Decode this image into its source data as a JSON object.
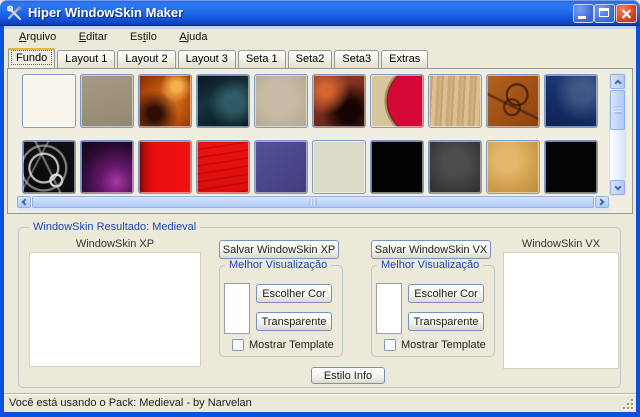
{
  "titlebar": {
    "title": "Hiper WindowSkin Maker",
    "icon": "crossed-tools-icon"
  },
  "window_controls": {
    "minimize": "minimize-icon",
    "maximize": "maximize-icon",
    "close": "close-icon"
  },
  "menu": {
    "items": [
      {
        "label": "Arquivo",
        "mnemonic": "A"
      },
      {
        "label": "Editar",
        "mnemonic": "E"
      },
      {
        "label": "Estilo",
        "mnemonic": "t"
      },
      {
        "label": "Ajuda",
        "mnemonic": "A"
      }
    ]
  },
  "tabs": [
    {
      "label": "Fundo",
      "selected": true
    },
    {
      "label": "Layout 1",
      "selected": false
    },
    {
      "label": "Layout 2",
      "selected": false
    },
    {
      "label": "Layout 3",
      "selected": false
    },
    {
      "label": "Seta 1",
      "selected": false
    },
    {
      "label": "Seta2",
      "selected": false
    },
    {
      "label": "Seta3",
      "selected": false
    },
    {
      "label": "Extras",
      "selected": false
    }
  ],
  "swatches": {
    "rows": [
      [
        {
          "name": "cream",
          "bg": "#f6f4eb"
        },
        {
          "name": "taupe",
          "bg": "linear-gradient(165deg,#a59a84,#93886f)"
        },
        {
          "name": "fire-marble",
          "bg": "radial-gradient(circle at 72% 22%, #f5b24a 0 8%, rgba(0,0,0,0) 30%), radial-gradient(circle at 30% 75%, #2d0d04 0 12%, rgba(0,0,0,0) 45%), radial-gradient(circle at 55% 55%, #e07a1e, #b44a0c 55%, #7e2a06)"
        },
        {
          "name": "dark-teal-stone",
          "bg": "radial-gradient(circle at 70% 55%, rgba(90,160,170,.4) 0 20%, rgba(0,0,0,0) 55%), linear-gradient(160deg,#0c1722 0%,#15333e 45%,#0a141e 100%)"
        },
        {
          "name": "sand",
          "bg": "radial-gradient(circle at 45% 45%, #c6bba4 0 40%, #b2a68e)"
        },
        {
          "name": "ember-rust",
          "bg": "radial-gradient(circle at 25% 30%, #d46630 0 10%, rgba(0,0,0,0) 45%), radial-gradient(circle at 70% 70%, #160503 0 20%, rgba(0,0,0,0) 55%), linear-gradient(150deg,#93402a,#5f1d10)"
        },
        {
          "name": "red-cream-curve",
          "bg": "radial-gradient(150% 130% at 118% 50%, #d40a34 0 56%, #a2132f 57% 58.5%, #a78b5e 59% 61%, #d6c69c 62%)"
        },
        {
          "name": "light-wood",
          "bg": "repeating-linear-gradient(93deg,#d3b183 0 2px,#c5a272 2px 4px,#dcbf92 4px 8px,#caa878 8px 11px)"
        },
        {
          "name": "dragon-etch",
          "bg": "radial-gradient(circle 12px at 58% 38%, rgba(0,0,0,0) 9px, rgba(50,22,6,.75) 9.5px 11px, rgba(0,0,0,0) 12px), radial-gradient(circle 9px at 48% 62%, rgba(0,0,0,0) 6.5px, rgba(50,22,6,.7) 7px 8.5px, rgba(0,0,0,0) 9.5px), linear-gradient(26deg, rgba(0,0,0,0) 40%, rgba(55,25,8,.6) 42% 43.5%, rgba(0,0,0,0) 46%), linear-gradient(135deg,#b2621f,#8f420e)"
        },
        {
          "name": "navy-smoke",
          "bg": "radial-gradient(circle at 70% 35%, rgba(130,150,170,.35) 0 18%, rgba(0,0,0,0) 55%), linear-gradient(205deg,#28477c 0%,#17316c 45%,#0e2252 100%)"
        }
      ],
      [
        {
          "name": "rune-circle",
          "bg": "radial-gradient(circle 16px at 40% 52%, rgba(0,0,0,0) 13px, rgba(230,230,230,.8) 13.5px 15px, rgba(0,0,0,0) 16px), radial-gradient(circle 24px at 40% 52%, rgba(0,0,0,0) 21px, rgba(200,200,200,.6) 21.5px 23px, rgba(0,0,0,0) 24px), radial-gradient(circle 7px at 64% 76%, rgba(0,0,0,0) 4.5px, rgba(240,240,240,.9) 5px 6.5px, rgba(0,0,0,0) 7.5px), linear-gradient(64deg, rgba(0,0,0,0) 46%, rgba(220,220,220,.5) 48% 49%, rgba(0,0,0,0) 51%), linear-gradient(118deg, rgba(0,0,0,0) 30%, rgba(220,220,220,.45) 31.5% 32.5%, rgba(0,0,0,0) 34%), linear-gradient(#101010,#0a0a0a)"
        },
        {
          "name": "purple-nebula",
          "bg": "radial-gradient(circle at 68% 78%, #a637a3 0%, #63176a 30%, #2c0a33 65%, #150419 100%)"
        },
        {
          "name": "red-shaded-edge",
          "bg": "linear-gradient(90deg,#6f0606 0%,#b50b0b 10%,#ea0f0f 28%,#f01212 100%)"
        },
        {
          "name": "red-streaks",
          "bg": "repeating-linear-gradient(171deg, rgba(150,10,10,.5) 0 1.5px, rgba(0,0,0,0) 1.5px 8px), linear-gradient(#ec1111,#dc0d0d)"
        },
        {
          "name": "indigo",
          "bg": "linear-gradient(140deg,#56519b,#413d7c)"
        },
        {
          "name": "light-beige",
          "bg": "#dedac9"
        },
        {
          "name": "black-1",
          "bg": "#020202"
        },
        {
          "name": "charcoal",
          "bg": "radial-gradient(circle at 50% 42%, #4c4c4a 0 30%, #333331 85%)"
        },
        {
          "name": "gold-parchment",
          "bg": "radial-gradient(circle at 38% 35%, #e2b76c 0 25%, #d0a04e 60%, #bd8c3a)"
        },
        {
          "name": "black-2",
          "bg": "#050505"
        }
      ]
    ]
  },
  "result": {
    "group_title": "WindowSkin Resultado: Medieval",
    "xp_preview_label": "WindowSkin XP",
    "vx_preview_label": "WindowSkin VX",
    "save_xp_label": "Salvar WindowSkin XP",
    "save_vx_label": "Salvar WindowSkin VX",
    "estilo_info_label": "Estilo Info",
    "viz_groups": [
      {
        "title": "Melhor Visualização",
        "choose_color_label": "Escolher Cor",
        "transparent_label": "Transparente",
        "show_template_label": "Mostrar Template",
        "checked": false
      },
      {
        "title": "Melhor Visualização",
        "choose_color_label": "Escolher Cor",
        "transparent_label": "Transparente",
        "show_template_label": "Mostrar Template",
        "checked": false
      }
    ]
  },
  "statusbar": {
    "text": "Você está usando o Pack: Medieval - by Narvelan"
  },
  "colors": {
    "frame_blue": "#0A51DC",
    "titlebar_a": "#2A60D8",
    "titlebar_b": "#2D79F4",
    "titlebar_c": "#1554DC",
    "titlebar_d": "#0B3CB0",
    "close_a": "#F0815F",
    "close_b": "#C33C1C",
    "winbtn_a": "#7AA1EF",
    "winbtn_b": "#3B67D6",
    "btn_border": "#7593BE",
    "gb_title_blue": "#1E46B4",
    "scroll_border": "#94B2E8",
    "scroll_face_a": "#D6E4FD",
    "scroll_face_b": "#AFC9F7",
    "swatch_border": "#7E9CC8",
    "status_text": "#1E1E1E",
    "client_bg": "#ECE9D8",
    "panel_bg": "#F0EEE1"
  }
}
